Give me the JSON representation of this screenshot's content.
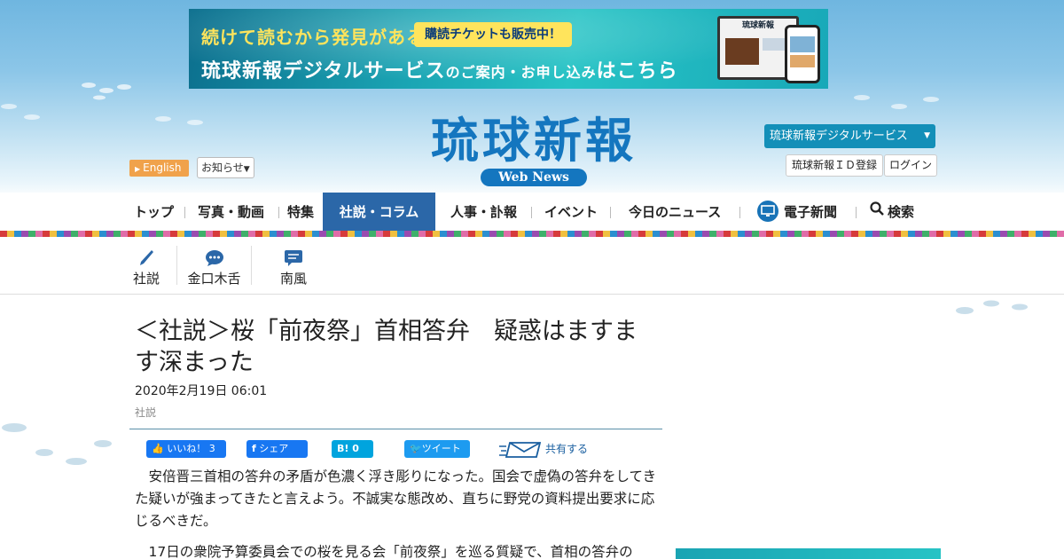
{
  "banner": {
    "line1": "続けて読むから発見がある",
    "ticket": "購読チケットも販売中！",
    "line2_a": "琉球新報デジタルサービス",
    "line2_b": "のご案内・お申し込み",
    "line2_c": "はこちら",
    "device_title": "琉球新報"
  },
  "logo": {
    "name": "琉球新報",
    "sub": "Web News"
  },
  "header": {
    "english_label": "English",
    "notice_label": "お知らせ",
    "digital_label": "琉球新報デジタルサービス",
    "id_register_label": "琉球新報ＩＤ登録",
    "login_label": "ログイン"
  },
  "nav": {
    "top": "トップ",
    "photo": "写真・動画",
    "special": "特集",
    "editorial": "社説・コラム",
    "personnel": "人事・訃報",
    "event": "イベント",
    "today": "今日のニュース",
    "epaper": "電子新聞",
    "search": "検索"
  },
  "subnav": {
    "editorial": "社説",
    "column": "金口木舌",
    "nanpu": "南風"
  },
  "article": {
    "title": "＜社説＞桜「前夜祭」首相答弁　疑惑はますます深まった",
    "date": "2020年2月19日 06:01",
    "category": "社説",
    "p1": "安倍晋三首相の答弁の矛盾が色濃く浮き彫りになった。国会で虚偽の答弁をしてきた疑いが強まってきたと言えよう。不誠実な態改め、直ちに野党の資料提出要求に応じるべきだ。",
    "p2": "17日の衆院予算委員会での桜を見る会「前夜祭」を巡る質疑で、首相の答弁の"
  },
  "share": {
    "like": "いいね！ 3",
    "fb_share": "シェア",
    "hatena": "B! 0",
    "tweet": "ツイート",
    "more": "共有する"
  },
  "colors": {
    "brand": "#1476bf",
    "nav_active": "#2b67a8",
    "digital_button": "#138fb8",
    "english_button": "#f0a24b"
  }
}
